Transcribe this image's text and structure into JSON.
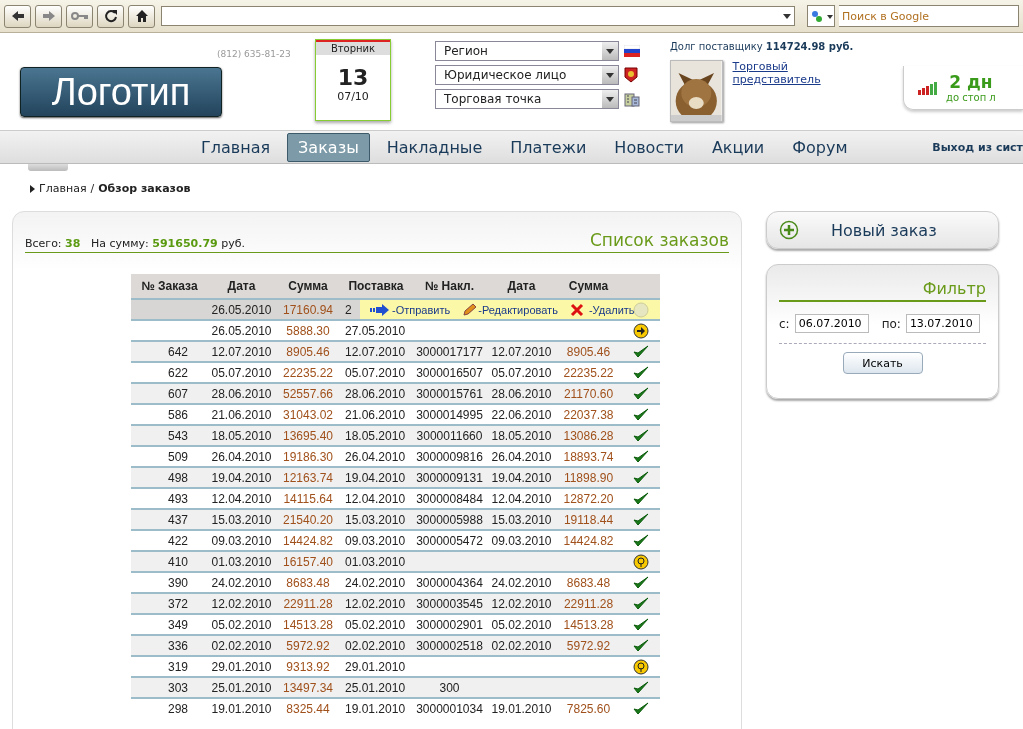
{
  "browser": {
    "search_placeholder": "Поиск в Google"
  },
  "header": {
    "phone": "(812) 635-81-23",
    "logo": "Логотип",
    "calendar": {
      "weekday": "Вторник",
      "day": "13",
      "month": "07/10"
    },
    "selects": [
      {
        "value": "Регион",
        "kind": "flag"
      },
      {
        "value": "Юридическое лицо",
        "kind": "emblem"
      },
      {
        "value": "Торговая точка",
        "kind": "building"
      }
    ],
    "debt_label": "Долг поставщику",
    "debt_value": "114724.98 руб.",
    "agent_link": "Торговый представитель",
    "days": "2 дн",
    "days_caption": "до стоп л"
  },
  "nav": [
    {
      "label": "Главная",
      "selected": false
    },
    {
      "label": "Заказы",
      "selected": true
    },
    {
      "label": "Накладные",
      "selected": false
    },
    {
      "label": "Платежи",
      "selected": false
    },
    {
      "label": "Новости",
      "selected": false
    },
    {
      "label": "Акции",
      "selected": false
    },
    {
      "label": "Форум",
      "selected": false
    }
  ],
  "logout": "Выход из сист",
  "breadcrumb": {
    "home": "Главная",
    "separator": "/",
    "current": "Обзор заказов"
  },
  "orders": {
    "title": "Список заказов",
    "total_label": "Всего:",
    "total": "38",
    "sum_label": "На сумму:",
    "sum": "591650.79",
    "currency": "руб.",
    "columns": [
      "№ Заказа",
      "Дата",
      "Сумма",
      "Поставка",
      "№ Накл.",
      "Дата",
      "Сумма"
    ],
    "popup": {
      "send": "-Отправить",
      "edit": "-Редактировать",
      "delete": "-Удалить"
    },
    "rows": [
      {
        "cells": [
          "",
          "26.05.2010",
          "17160.94",
          "2",
          "",
          "",
          ""
        ],
        "kind": "faded",
        "selected": true
      },
      {
        "cells": [
          "",
          "26.05.2010",
          "5888.30",
          "27.05.2010",
          "",
          "",
          ""
        ],
        "kind": "send",
        "selected": false
      },
      {
        "cells": [
          "642",
          "12.07.2010",
          "8905.46",
          "12.07.2010",
          "3000017177",
          "12.07.2010",
          "8905.46"
        ],
        "kind": "done",
        "selected": false
      },
      {
        "cells": [
          "622",
          "05.07.2010",
          "22235.22",
          "05.07.2010",
          "3000016507",
          "05.07.2010",
          "22235.22"
        ],
        "kind": "done",
        "selected": false
      },
      {
        "cells": [
          "607",
          "28.06.2010",
          "52557.66",
          "28.06.2010",
          "3000015761",
          "28.06.2010",
          "21170.60"
        ],
        "kind": "done",
        "selected": false
      },
      {
        "cells": [
          "586",
          "21.06.2010",
          "31043.02",
          "21.06.2010",
          "3000014995",
          "22.06.2010",
          "22037.38"
        ],
        "kind": "done",
        "selected": false
      },
      {
        "cells": [
          "543",
          "18.05.2010",
          "13695.40",
          "18.05.2010",
          "3000011660",
          "18.05.2010",
          "13086.28"
        ],
        "kind": "done",
        "selected": false
      },
      {
        "cells": [
          "509",
          "26.04.2010",
          "19186.30",
          "26.04.2010",
          "3000009816",
          "26.04.2010",
          "18893.74"
        ],
        "kind": "done",
        "selected": false
      },
      {
        "cells": [
          "498",
          "19.04.2010",
          "12163.74",
          "19.04.2010",
          "3000009131",
          "19.04.2010",
          "11898.90"
        ],
        "kind": "done",
        "selected": false
      },
      {
        "cells": [
          "493",
          "12.04.2010",
          "14115.64",
          "12.04.2010",
          "3000008484",
          "12.04.2010",
          "12872.20"
        ],
        "kind": "done",
        "selected": false
      },
      {
        "cells": [
          "437",
          "15.03.2010",
          "21540.20",
          "15.03.2010",
          "3000005988",
          "15.03.2010",
          "19118.44"
        ],
        "kind": "done",
        "selected": false
      },
      {
        "cells": [
          "422",
          "09.03.2010",
          "14424.82",
          "09.03.2010",
          "3000005472",
          "09.03.2010",
          "14424.82"
        ],
        "kind": "done",
        "selected": false
      },
      {
        "cells": [
          "410",
          "01.03.2010",
          "16157.40",
          "01.03.2010",
          "",
          "",
          ""
        ],
        "kind": "pending",
        "selected": false
      },
      {
        "cells": [
          "390",
          "24.02.2010",
          "8683.48",
          "24.02.2010",
          "3000004364",
          "24.02.2010",
          "8683.48"
        ],
        "kind": "done",
        "selected": false
      },
      {
        "cells": [
          "372",
          "12.02.2010",
          "22911.28",
          "12.02.2010",
          "3000003545",
          "12.02.2010",
          "22911.28"
        ],
        "kind": "done",
        "selected": false
      },
      {
        "cells": [
          "349",
          "05.02.2010",
          "14513.28",
          "05.02.2010",
          "3000002901",
          "05.02.2010",
          "14513.28"
        ],
        "kind": "done",
        "selected": false
      },
      {
        "cells": [
          "336",
          "02.02.2010",
          "5972.92",
          "02.02.2010",
          "3000002518",
          "02.02.2010",
          "5972.92"
        ],
        "kind": "done",
        "selected": false
      },
      {
        "cells": [
          "319",
          "29.01.2010",
          "9313.92",
          "29.01.2010",
          "",
          "",
          ""
        ],
        "kind": "pending",
        "selected": false
      },
      {
        "cells": [
          "303",
          "25.01.2010",
          "13497.34",
          "25.01.2010",
          "300",
          "",
          ""
        ],
        "kind": "done",
        "selected": false
      },
      {
        "cells": [
          "298",
          "19.01.2010",
          "8325.44",
          "19.01.2010",
          "3000001034",
          "19.01.2010",
          "7825.60"
        ],
        "kind": "done",
        "selected": false
      }
    ]
  },
  "new_order": "Новый заказ",
  "filter": {
    "title": "Фильтр",
    "from_label": "с:",
    "from": "06.07.2010",
    "to_label": "по:",
    "to": "13.07.2010",
    "button": "Искать"
  }
}
